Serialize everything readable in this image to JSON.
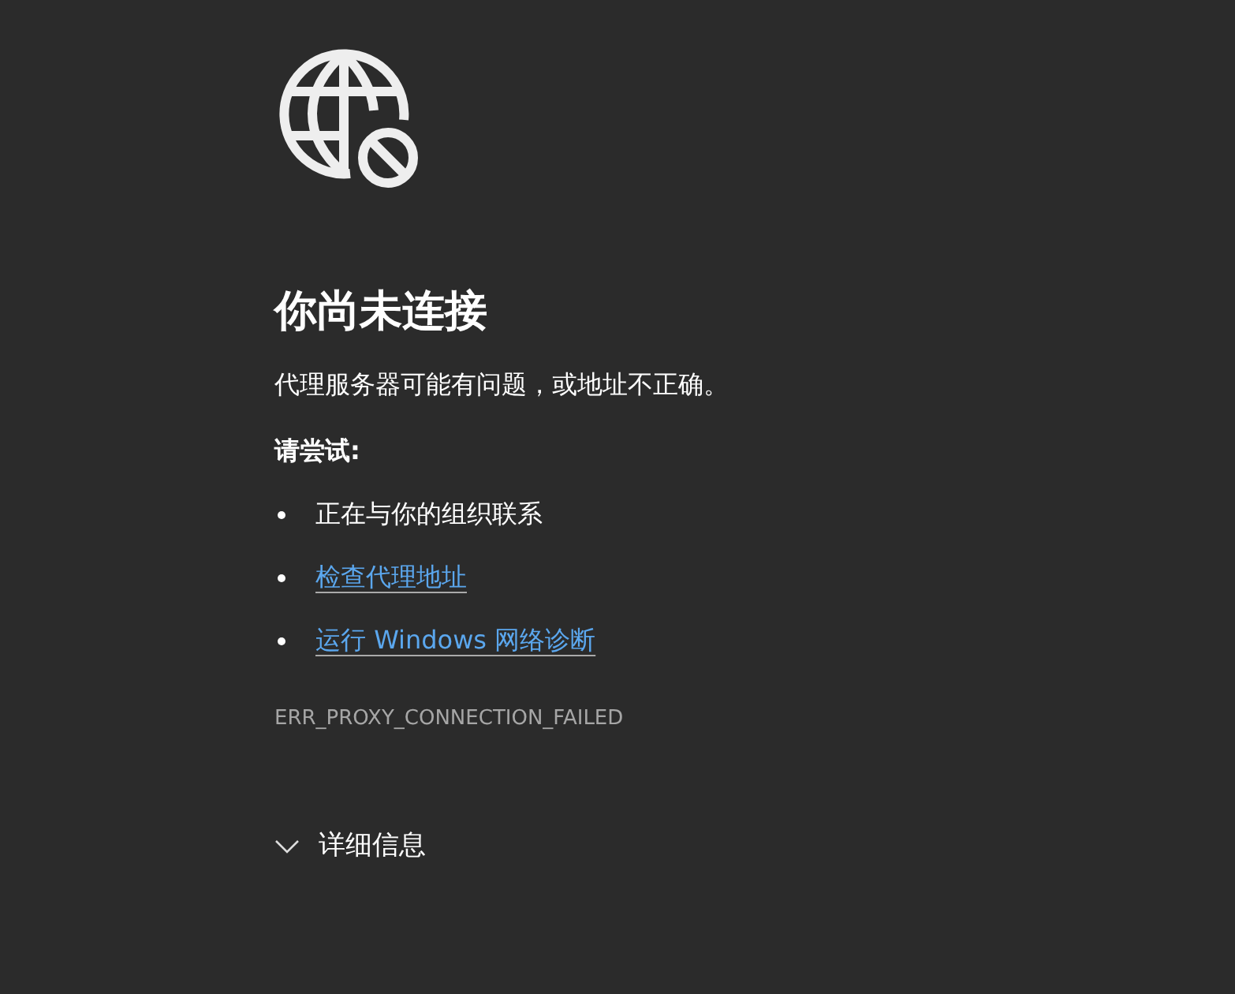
{
  "title": "你尚未连接",
  "message": "代理服务器可能有问题，或地址不正确。",
  "suggestions_heading": "请尝试:",
  "suggestions": [
    {
      "kind": "text",
      "label": "正在与你的组织联系"
    },
    {
      "kind": "link",
      "label": "检查代理地址"
    },
    {
      "kind": "link",
      "label": "运行 Windows 网络诊断"
    }
  ],
  "error_code": "ERR_PROXY_CONNECTION_FAILED",
  "details": {
    "label": "详细信息",
    "expanded": false
  }
}
